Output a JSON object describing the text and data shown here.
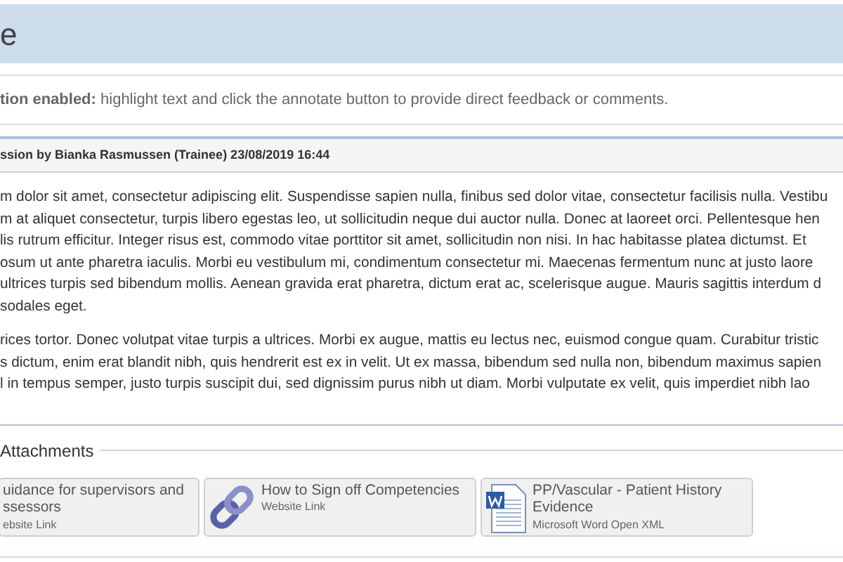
{
  "page_title": "e",
  "notice": "**tion enabled:** highlight text and click the annotate button to provide direct feedback or comments.",
  "submission": {
    "header": "ssion by Bianka Rasmussen (Trainee) 23/08/2019 16:44",
    "paragraphs": [
      [
        "m dolor sit amet, consectetur adipiscing elit. Suspendisse sapien nulla, finibus sed dolor vitae, consectetur facilisis nulla. Vestibu",
        "m at aliquet consectetur, turpis libero egestas leo, ut sollicitudin neque dui auctor nulla. Donec at laoreet orci. Pellentesque hen",
        "lis rutrum efficitur. Integer risus est, commodo vitae porttitor sit amet, sollicitudin non nisi. In hac habitasse platea dictumst. Et",
        "osum ut ante pharetra iaculis. Morbi eu vestibulum mi, condimentum consectetur mi. Maecenas fermentum nunc at justo laore",
        "ultrices turpis sed bibendum mollis. Aenean gravida erat pharetra, dictum erat ac, scelerisque augue. Mauris sagittis interdum d",
        "sodales eget."
      ],
      [
        "rices tortor. Donec volutpat vitae turpis a ultrices. Morbi ex augue, mattis eu lectus nec, euismod congue quam. Curabitur tristic",
        "s dictum, enim erat blandit nibh, quis hendrerit est ex in velit. Ut ex massa, bibendum sed nulla non, bibendum maximus sapien",
        "l in tempus semper, justo turpis suscipit dui, sed dignissim purus nibh ut diam. Morbi vulputate ex velit, quis imperdiet nibh lao"
      ]
    ]
  },
  "attachments": {
    "heading": "Attachments",
    "items": [
      {
        "kind": "clipped",
        "title_lines": [
          "uidance for supervisors and",
          "ssessors"
        ],
        "type": "ebsite Link"
      },
      {
        "kind": "link",
        "title_lines": [
          "How to Sign off Competencies"
        ],
        "type": "Website Link"
      },
      {
        "kind": "word",
        "title_lines": [
          "PP/Vascular - Patient History",
          "Evidence"
        ],
        "type": "Microsoft Word Open XML"
      }
    ]
  }
}
